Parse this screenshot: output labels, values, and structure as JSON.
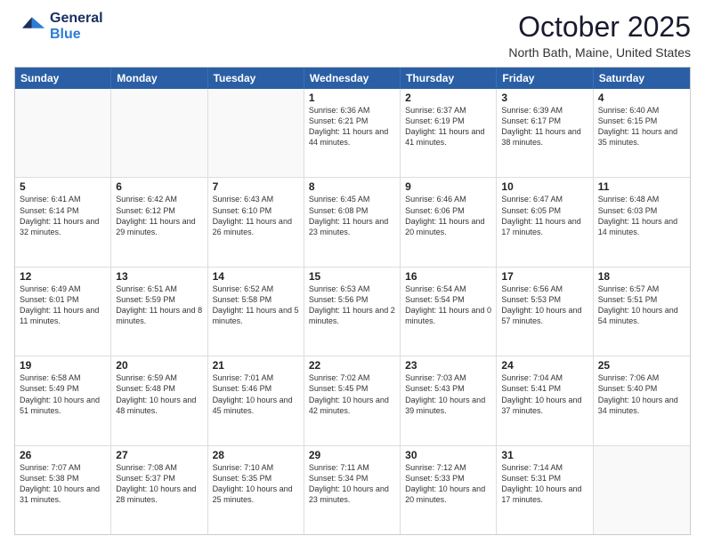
{
  "header": {
    "logo_general": "General",
    "logo_blue": "Blue",
    "month_title": "October 2025",
    "location": "North Bath, Maine, United States"
  },
  "weekdays": [
    "Sunday",
    "Monday",
    "Tuesday",
    "Wednesday",
    "Thursday",
    "Friday",
    "Saturday"
  ],
  "rows": [
    [
      {
        "day": "",
        "sunrise": "",
        "sunset": "",
        "daylight": "",
        "empty": true
      },
      {
        "day": "",
        "sunrise": "",
        "sunset": "",
        "daylight": "",
        "empty": true
      },
      {
        "day": "",
        "sunrise": "",
        "sunset": "",
        "daylight": "",
        "empty": true
      },
      {
        "day": "1",
        "sunrise": "Sunrise: 6:36 AM",
        "sunset": "Sunset: 6:21 PM",
        "daylight": "Daylight: 11 hours and 44 minutes."
      },
      {
        "day": "2",
        "sunrise": "Sunrise: 6:37 AM",
        "sunset": "Sunset: 6:19 PM",
        "daylight": "Daylight: 11 hours and 41 minutes."
      },
      {
        "day": "3",
        "sunrise": "Sunrise: 6:39 AM",
        "sunset": "Sunset: 6:17 PM",
        "daylight": "Daylight: 11 hours and 38 minutes."
      },
      {
        "day": "4",
        "sunrise": "Sunrise: 6:40 AM",
        "sunset": "Sunset: 6:15 PM",
        "daylight": "Daylight: 11 hours and 35 minutes."
      }
    ],
    [
      {
        "day": "5",
        "sunrise": "Sunrise: 6:41 AM",
        "sunset": "Sunset: 6:14 PM",
        "daylight": "Daylight: 11 hours and 32 minutes."
      },
      {
        "day": "6",
        "sunrise": "Sunrise: 6:42 AM",
        "sunset": "Sunset: 6:12 PM",
        "daylight": "Daylight: 11 hours and 29 minutes."
      },
      {
        "day": "7",
        "sunrise": "Sunrise: 6:43 AM",
        "sunset": "Sunset: 6:10 PM",
        "daylight": "Daylight: 11 hours and 26 minutes."
      },
      {
        "day": "8",
        "sunrise": "Sunrise: 6:45 AM",
        "sunset": "Sunset: 6:08 PM",
        "daylight": "Daylight: 11 hours and 23 minutes."
      },
      {
        "day": "9",
        "sunrise": "Sunrise: 6:46 AM",
        "sunset": "Sunset: 6:06 PM",
        "daylight": "Daylight: 11 hours and 20 minutes."
      },
      {
        "day": "10",
        "sunrise": "Sunrise: 6:47 AM",
        "sunset": "Sunset: 6:05 PM",
        "daylight": "Daylight: 11 hours and 17 minutes."
      },
      {
        "day": "11",
        "sunrise": "Sunrise: 6:48 AM",
        "sunset": "Sunset: 6:03 PM",
        "daylight": "Daylight: 11 hours and 14 minutes."
      }
    ],
    [
      {
        "day": "12",
        "sunrise": "Sunrise: 6:49 AM",
        "sunset": "Sunset: 6:01 PM",
        "daylight": "Daylight: 11 hours and 11 minutes."
      },
      {
        "day": "13",
        "sunrise": "Sunrise: 6:51 AM",
        "sunset": "Sunset: 5:59 PM",
        "daylight": "Daylight: 11 hours and 8 minutes."
      },
      {
        "day": "14",
        "sunrise": "Sunrise: 6:52 AM",
        "sunset": "Sunset: 5:58 PM",
        "daylight": "Daylight: 11 hours and 5 minutes."
      },
      {
        "day": "15",
        "sunrise": "Sunrise: 6:53 AM",
        "sunset": "Sunset: 5:56 PM",
        "daylight": "Daylight: 11 hours and 2 minutes."
      },
      {
        "day": "16",
        "sunrise": "Sunrise: 6:54 AM",
        "sunset": "Sunset: 5:54 PM",
        "daylight": "Daylight: 11 hours and 0 minutes."
      },
      {
        "day": "17",
        "sunrise": "Sunrise: 6:56 AM",
        "sunset": "Sunset: 5:53 PM",
        "daylight": "Daylight: 10 hours and 57 minutes."
      },
      {
        "day": "18",
        "sunrise": "Sunrise: 6:57 AM",
        "sunset": "Sunset: 5:51 PM",
        "daylight": "Daylight: 10 hours and 54 minutes."
      }
    ],
    [
      {
        "day": "19",
        "sunrise": "Sunrise: 6:58 AM",
        "sunset": "Sunset: 5:49 PM",
        "daylight": "Daylight: 10 hours and 51 minutes."
      },
      {
        "day": "20",
        "sunrise": "Sunrise: 6:59 AM",
        "sunset": "Sunset: 5:48 PM",
        "daylight": "Daylight: 10 hours and 48 minutes."
      },
      {
        "day": "21",
        "sunrise": "Sunrise: 7:01 AM",
        "sunset": "Sunset: 5:46 PM",
        "daylight": "Daylight: 10 hours and 45 minutes."
      },
      {
        "day": "22",
        "sunrise": "Sunrise: 7:02 AM",
        "sunset": "Sunset: 5:45 PM",
        "daylight": "Daylight: 10 hours and 42 minutes."
      },
      {
        "day": "23",
        "sunrise": "Sunrise: 7:03 AM",
        "sunset": "Sunset: 5:43 PM",
        "daylight": "Daylight: 10 hours and 39 minutes."
      },
      {
        "day": "24",
        "sunrise": "Sunrise: 7:04 AM",
        "sunset": "Sunset: 5:41 PM",
        "daylight": "Daylight: 10 hours and 37 minutes."
      },
      {
        "day": "25",
        "sunrise": "Sunrise: 7:06 AM",
        "sunset": "Sunset: 5:40 PM",
        "daylight": "Daylight: 10 hours and 34 minutes."
      }
    ],
    [
      {
        "day": "26",
        "sunrise": "Sunrise: 7:07 AM",
        "sunset": "Sunset: 5:38 PM",
        "daylight": "Daylight: 10 hours and 31 minutes."
      },
      {
        "day": "27",
        "sunrise": "Sunrise: 7:08 AM",
        "sunset": "Sunset: 5:37 PM",
        "daylight": "Daylight: 10 hours and 28 minutes."
      },
      {
        "day": "28",
        "sunrise": "Sunrise: 7:10 AM",
        "sunset": "Sunset: 5:35 PM",
        "daylight": "Daylight: 10 hours and 25 minutes."
      },
      {
        "day": "29",
        "sunrise": "Sunrise: 7:11 AM",
        "sunset": "Sunset: 5:34 PM",
        "daylight": "Daylight: 10 hours and 23 minutes."
      },
      {
        "day": "30",
        "sunrise": "Sunrise: 7:12 AM",
        "sunset": "Sunset: 5:33 PM",
        "daylight": "Daylight: 10 hours and 20 minutes."
      },
      {
        "day": "31",
        "sunrise": "Sunrise: 7:14 AM",
        "sunset": "Sunset: 5:31 PM",
        "daylight": "Daylight: 10 hours and 17 minutes."
      },
      {
        "day": "",
        "sunrise": "",
        "sunset": "",
        "daylight": "",
        "empty": true
      }
    ]
  ]
}
